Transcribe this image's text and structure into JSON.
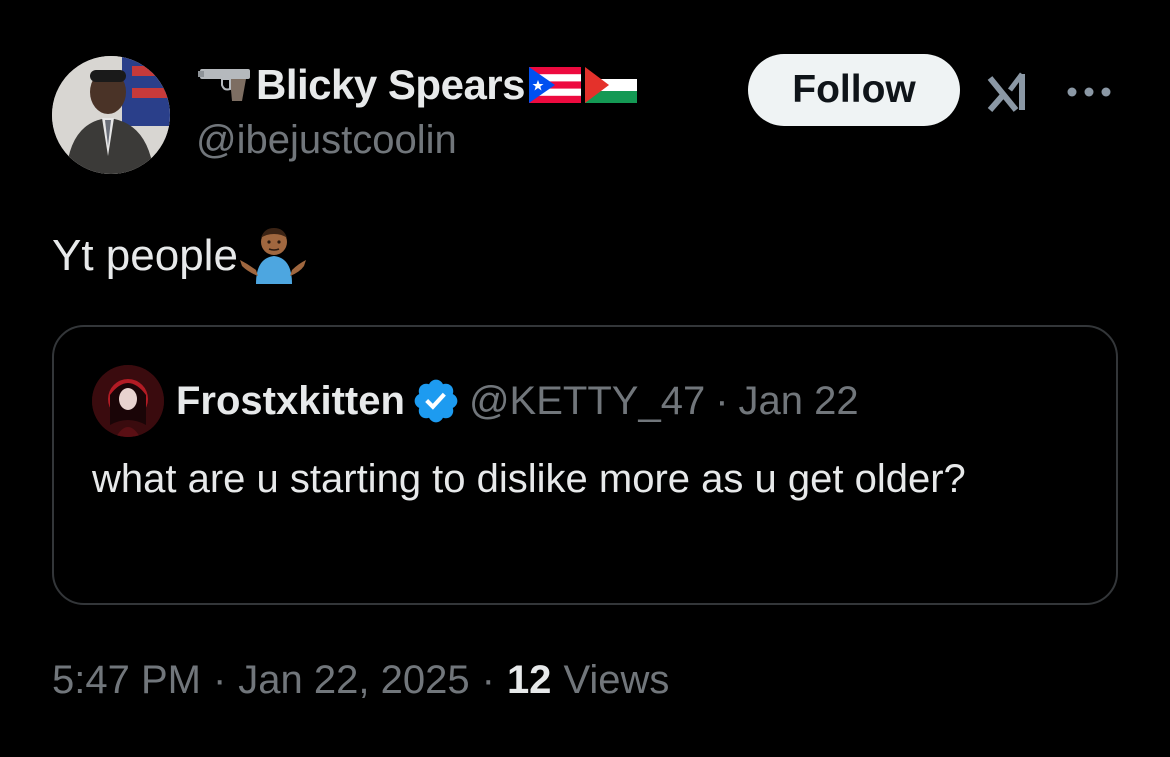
{
  "author": {
    "display_name": "Blicky Spears",
    "handle": "@ibejustcoolin",
    "icons": [
      "pistol-icon",
      "puerto-rico-flag-icon",
      "palestine-flag-icon"
    ]
  },
  "actions": {
    "follow_label": "Follow",
    "grok_icon": "grok-icon",
    "more_icon": "more-icon"
  },
  "tweet": {
    "text": "Yt people",
    "emoji": "person-shrugging-icon"
  },
  "quoted_tweet": {
    "display_name": "Frostxkitten",
    "handle": "@KETTY_47",
    "separator": "·",
    "date": "Jan 22",
    "text": "what are u starting to dislike more as u get older?",
    "verified_color": "#1d9bf0"
  },
  "meta": {
    "time": "5:47 PM",
    "separator": "·",
    "date": "Jan 22, 2025",
    "views_count": "12",
    "views_label": "Views"
  },
  "colors": {
    "background": "#000000",
    "text_primary": "#e7e9ea",
    "text_secondary": "#71767b",
    "border": "#333639",
    "follow_bg": "#eff3f4"
  }
}
